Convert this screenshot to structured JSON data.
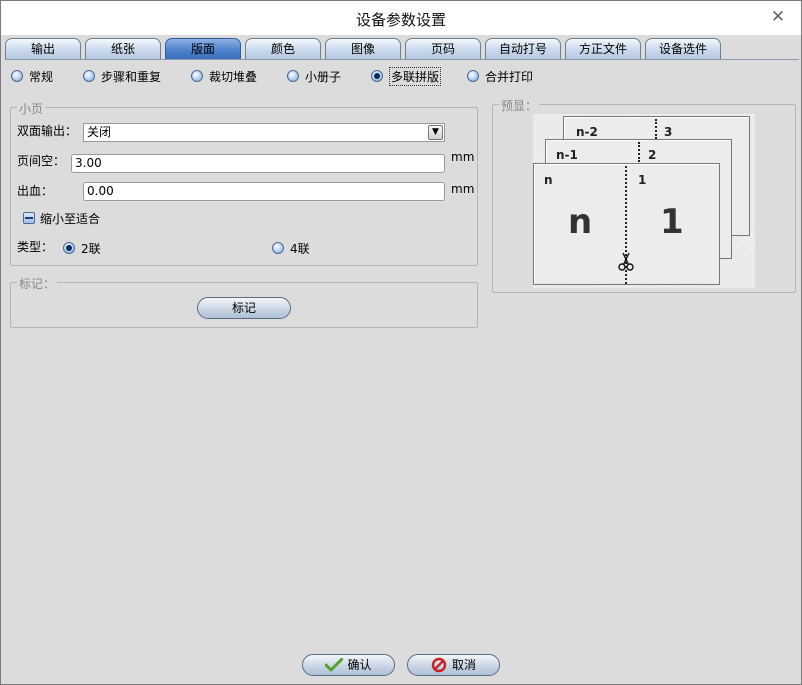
{
  "window": {
    "title": "设备参数设置",
    "close_glyph": "✕"
  },
  "tabs": [
    {
      "label": "输出",
      "active": false
    },
    {
      "label": "纸张",
      "active": false
    },
    {
      "label": "版面",
      "active": true
    },
    {
      "label": "颜色",
      "active": false
    },
    {
      "label": "图像",
      "active": false
    },
    {
      "label": "页码",
      "active": false
    },
    {
      "label": "自动打号",
      "active": false
    },
    {
      "label": "方正文件",
      "active": false
    },
    {
      "label": "设备选件",
      "active": false
    }
  ],
  "layout_modes": [
    {
      "label": "常规",
      "checked": false
    },
    {
      "label": "步骤和重复",
      "checked": false
    },
    {
      "label": "裁切堆叠",
      "checked": false
    },
    {
      "label": "小册子",
      "checked": false
    },
    {
      "label": "多联拼版",
      "checked": true
    },
    {
      "label": "合并打印",
      "checked": false
    }
  ],
  "small_page": {
    "legend": "小页",
    "duplex_label": "双面输出：",
    "duplex_value": "关闭",
    "gap_label": "页间空：",
    "gap_value": "3.00",
    "gap_unit": "mm",
    "bleed_label": "出血：",
    "bleed_value": "0.00",
    "bleed_unit": "mm",
    "shrink_label": "缩小至适合",
    "type_label": "类型：",
    "type_options": [
      {
        "label": "2联",
        "checked": true
      },
      {
        "label": "4联",
        "checked": false
      }
    ]
  },
  "marks": {
    "legend": "标记：",
    "button_label": "标记"
  },
  "preview": {
    "legend": "预显：",
    "back_sheet": {
      "left": "n-2",
      "right": "3"
    },
    "mid_sheet": {
      "left": "n-1",
      "right": "2"
    },
    "front_sheet": {
      "left": "n",
      "right": "1",
      "big_left": "n",
      "big_right": "1"
    },
    "scissors_icon": "scissors-icon"
  },
  "footer": {
    "ok_label": "确认",
    "cancel_label": "取消"
  },
  "colors": {
    "active_tab": "#4f83cc",
    "ok_icon": "#5aa02c",
    "cancel_icon": "#cc2020"
  }
}
